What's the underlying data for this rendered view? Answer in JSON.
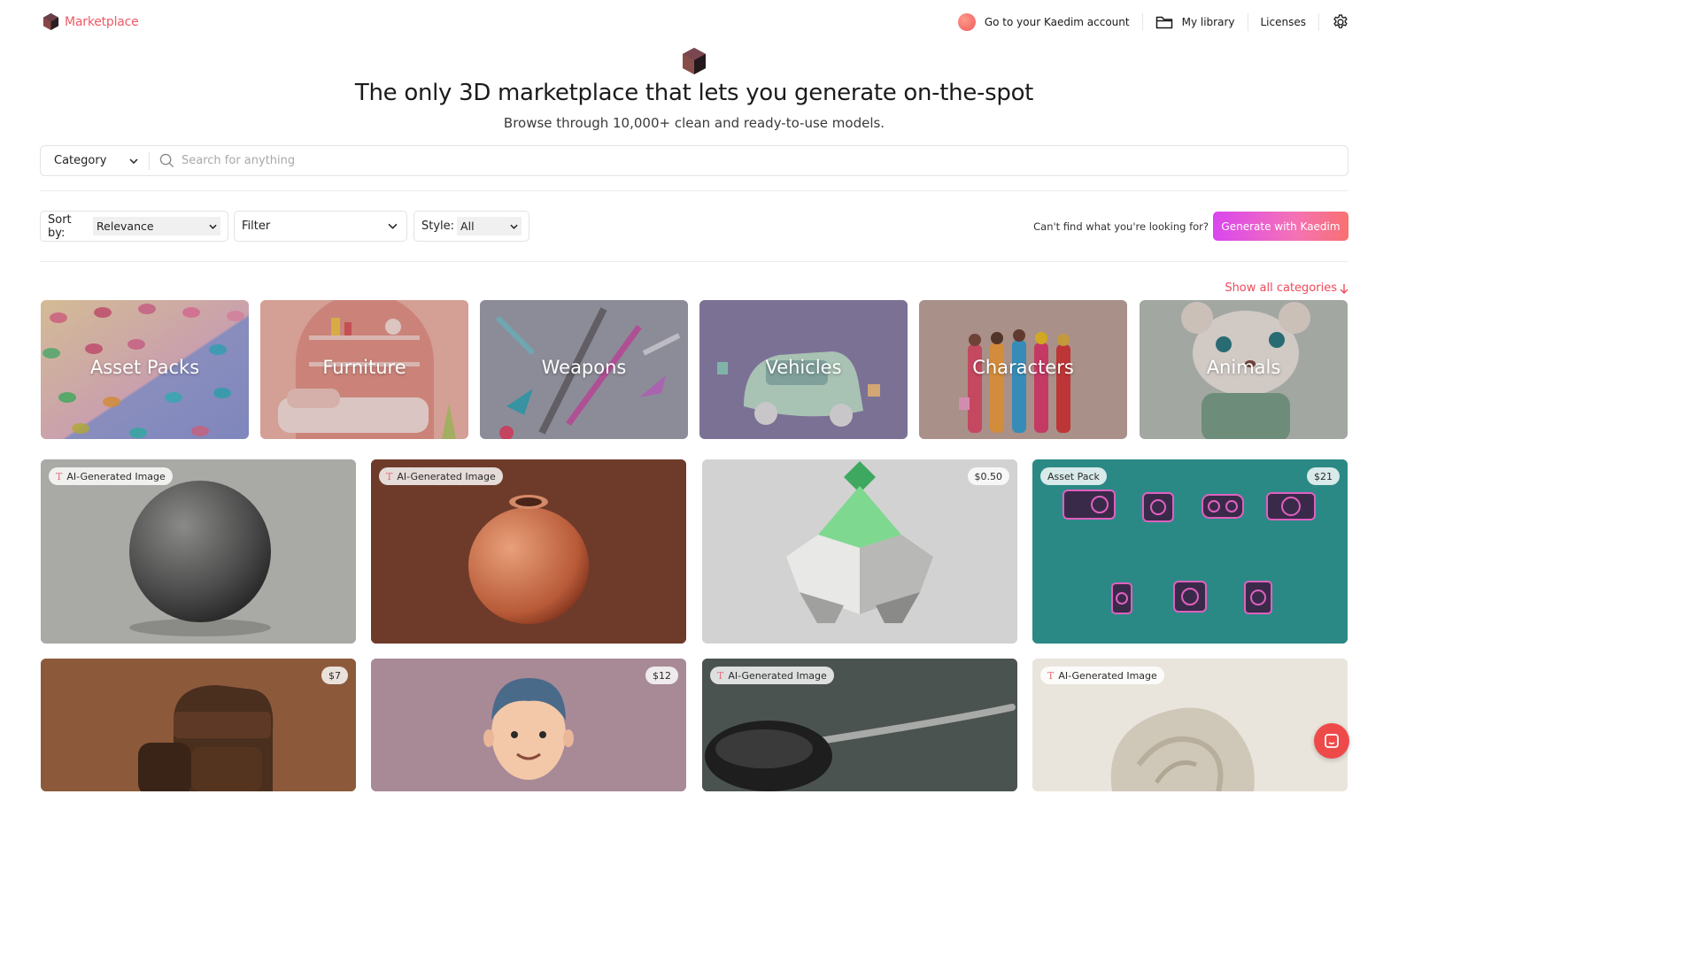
{
  "header": {
    "brand": "Marketplace",
    "account_link": "Go to your Kaedim account",
    "library_link": "My library",
    "licenses_link": "Licenses"
  },
  "hero": {
    "title": "The only 3D marketplace that lets you generate on-the-spot",
    "subtitle": "Browse through 10,000+ clean and ready-to-use models."
  },
  "search": {
    "category_label": "Category",
    "placeholder": "Search for anything"
  },
  "filters": {
    "sort_label": "Sort by:",
    "sort_value": "Relevance",
    "filter_label": "Filter",
    "style_label": "Style:",
    "style_value": "All",
    "cant_find": "Can't find what you're looking for?",
    "generate_button": "Generate with Kaedim"
  },
  "categories": {
    "show_all": "Show all categories",
    "items": [
      {
        "label": "Asset Packs"
      },
      {
        "label": "Furniture"
      },
      {
        "label": "Weapons"
      },
      {
        "label": "Vehicles"
      },
      {
        "label": "Characters"
      },
      {
        "label": "Animals"
      }
    ]
  },
  "products": [
    {
      "badge": "AI-Generated Image",
      "price": "",
      "subject": "sphere"
    },
    {
      "badge": "AI-Generated Image",
      "price": "",
      "subject": "clay-pot"
    },
    {
      "badge": "",
      "price": "$0.50",
      "subject": "low-poly-creature"
    },
    {
      "badge": "Asset Pack",
      "price": "$21",
      "subject": "speakers-pack"
    },
    {
      "badge": "",
      "price": "$7",
      "subject": "armchair"
    },
    {
      "badge": "",
      "price": "$12",
      "subject": "cartoon-man"
    },
    {
      "badge": "AI-Generated Image",
      "price": "",
      "subject": "spoon"
    },
    {
      "badge": "AI-Generated Image",
      "price": "",
      "subject": "blanket"
    }
  ],
  "colors": {
    "brand": "#ef5a66",
    "accent_gradient_start": "#d946ef",
    "accent_gradient_end": "#f87171"
  }
}
